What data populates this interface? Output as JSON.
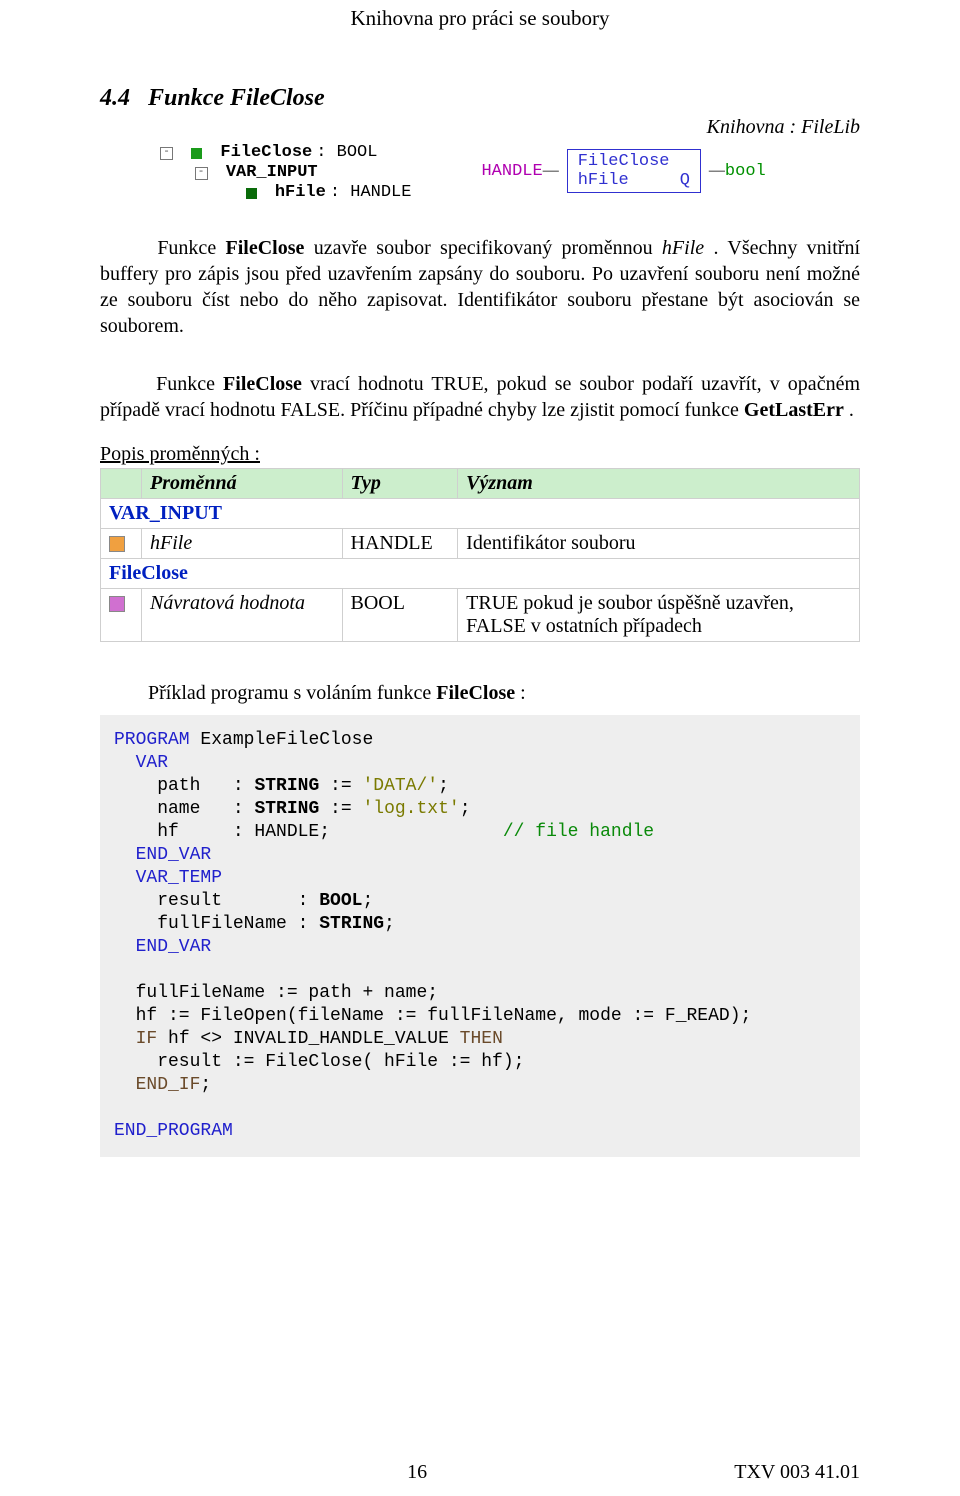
{
  "header": "Knihovna pro práci se soubory",
  "section": {
    "number": "4.4",
    "title": "Funkce FileClose"
  },
  "library_line": {
    "label": "Knihovna :",
    "name": "FileLib"
  },
  "tree": {
    "fileclose": "FileClose",
    "bool": ": BOOL",
    "var_input": "VAR_INPUT",
    "hfile": "hFile",
    "handle": ": HANDLE"
  },
  "block": {
    "port_in": "HANDLE",
    "name": "FileClose",
    "line2_left": "hFile",
    "line2_right": "Q",
    "port_out": "bool"
  },
  "para1_a": "Funkce ",
  "para1_b": "FileClose",
  "para1_c": " uzavře soubor specifikovaný proměnnou ",
  "para1_d": "hFile",
  "para1_e": ". Všechny vnitřní buffery pro zápis jsou před uzavřením zapsány do souboru. Po uzavření souboru není možné ze souboru číst nebo do něho zapisovat. Identifikátor souboru přestane být asociován se souborem.",
  "para2_a": "Funkce ",
  "para2_b": "FileClose",
  "para2_c": " vrací hodnotu TRUE, pokud se soubor podaří uzavřít, v opačném případě vrací hodnotu FALSE. Příčinu případné chyby lze zjistit pomocí funkce ",
  "para2_d": "GetLastErr",
  "para2_e": ".",
  "table_title": "Popis proměnných :",
  "table": {
    "head": {
      "c1": "Proměnná",
      "c2": "Typ",
      "c3": "Význam"
    },
    "var_input": "VAR_INPUT",
    "r1": {
      "c1": "hFile",
      "c2": "HANDLE",
      "c3": "Identifikátor souboru"
    },
    "fileclose": "FileClose",
    "r2": {
      "c1": "Návratová hodnota",
      "c2": "BOOL",
      "c3a": "TRUE pokud je soubor úspěšně uzavřen,",
      "c3b": "FALSE v ostatních případech"
    }
  },
  "example_label_a": "Příklad programu s voláním funkce ",
  "example_label_b": "FileClose",
  "example_label_c": " :",
  "code": {
    "l1": "PROGRAM",
    "l1b": " ExampleFileClose",
    "l2": "  VAR",
    "l3a": "    path   : ",
    "l3b": "STRING",
    "l3c": " := ",
    "l3d": "'DATA/'",
    "l3e": ";",
    "l4a": "    name   : ",
    "l4b": "STRING",
    "l4c": " := ",
    "l4d": "'log.txt'",
    "l4e": ";",
    "l5a": "    hf     : HANDLE;                ",
    "l5b": "// file handle",
    "l6": "  END_VAR",
    "l7": "  VAR_TEMP",
    "l8a": "    result       : ",
    "l8b": "BOOL",
    "l8c": ";",
    "l9a": "    fullFileName : ",
    "l9b": "STRING",
    "l9c": ";",
    "l10": "  END_VAR",
    "l11": "",
    "l12": "  fullFileName := path + name;",
    "l13": "  hf := FileOpen(fileName := fullFileName, mode := F_READ);",
    "l14a": "  IF",
    "l14b": " hf <> INVALID_HANDLE_VALUE ",
    "l14c": "THEN",
    "l15": "    result := FileClose( hFile := hf);",
    "l16": "  END_IF",
    "l16b": ";",
    "l17": "",
    "l18": "END_PROGRAM"
  },
  "footer": {
    "page": "16",
    "docid": "TXV 003 41.01"
  }
}
